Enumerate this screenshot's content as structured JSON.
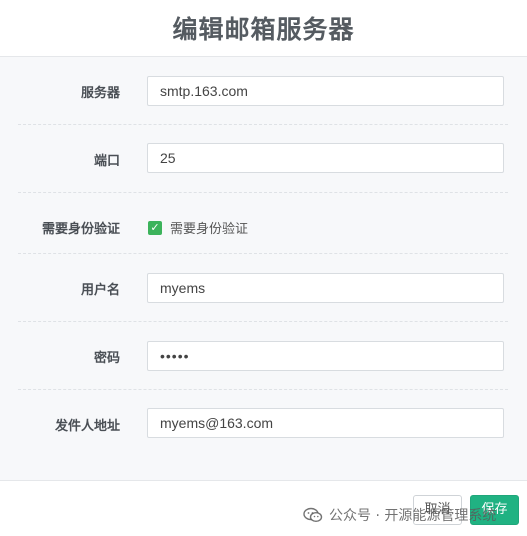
{
  "dialog": {
    "title": "编辑邮箱服务器"
  },
  "form": {
    "server": {
      "label": "服务器",
      "value": "smtp.163.com"
    },
    "port": {
      "label": "端口",
      "value": "25"
    },
    "auth": {
      "label": "需要身份验证",
      "checkbox_label": "需要身份验证",
      "checked": true
    },
    "username": {
      "label": "用户名",
      "value": "myems"
    },
    "password": {
      "label": "密码",
      "value": "•••••"
    },
    "sender": {
      "label": "发件人地址",
      "value": "myems@163.com"
    }
  },
  "footer": {
    "cancel_label": "取消",
    "save_label": "保存"
  },
  "watermark": {
    "text": "公众号 · 开源能源管理系统"
  },
  "colors": {
    "accent": "#20b282",
    "checkbox": "#3cb35b"
  }
}
